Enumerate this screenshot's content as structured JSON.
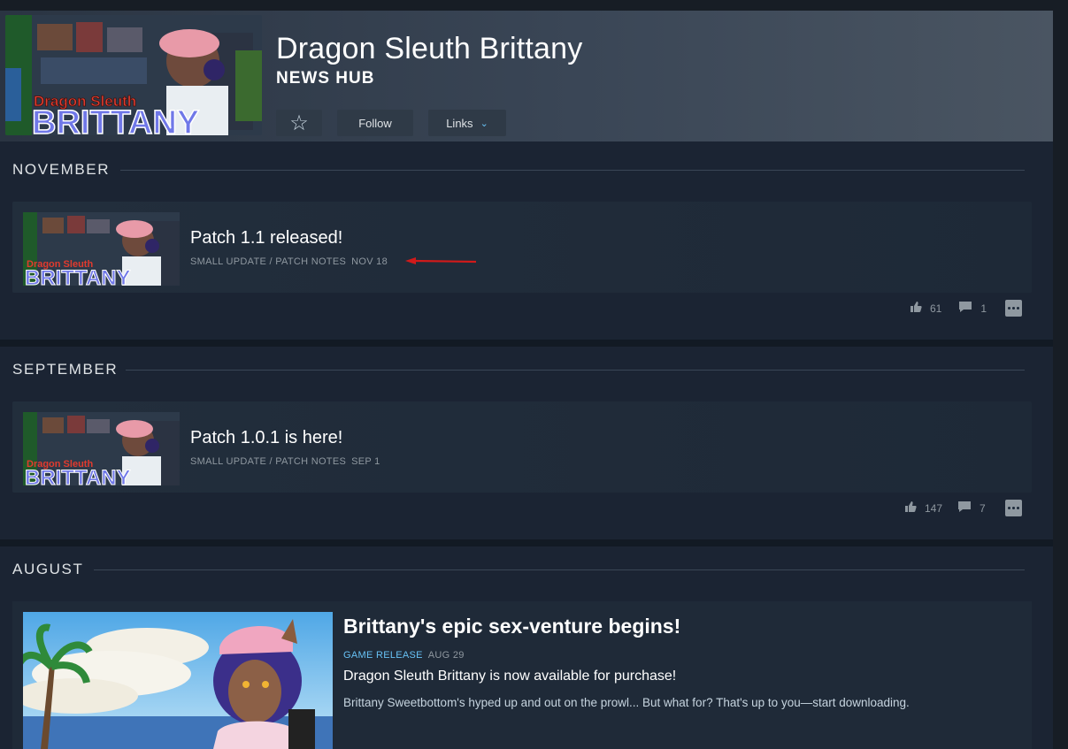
{
  "header": {
    "app_title": "Dragon Sleuth Brittany",
    "subtitle": "NEWS HUB",
    "art_text_top": "Dragon Sleuth",
    "art_text_bottom": "BRITTANY",
    "buttons": {
      "star_icon": "star-outline-icon",
      "follow_label": "Follow",
      "links_label": "Links"
    }
  },
  "sections": [
    {
      "month": "NOVEMBER",
      "posts": [
        {
          "title": "Patch 1.1 released!",
          "category": "SMALL UPDATE / PATCH NOTES",
          "date": "NOV 18",
          "likes": "61",
          "comments": "1"
        }
      ]
    },
    {
      "month": "SEPTEMBER",
      "posts": [
        {
          "title": "Patch 1.0.1 is here!",
          "category": "SMALL UPDATE / PATCH NOTES",
          "date": "SEP 1",
          "likes": "147",
          "comments": "7"
        }
      ]
    },
    {
      "month": "AUGUST",
      "posts": [
        {
          "title": "Brittany's epic sex-venture begins!",
          "category": "GAME RELEASE",
          "date": "AUG 29",
          "subtitle": "Dragon Sleuth Brittany is now available for purchase!",
          "body": "Brittany Sweetbottom's hyped up and out on the prowl... But what for? That's up to you—start downloading."
        }
      ]
    }
  ],
  "colors": {
    "accent_blue": "#67c1f5",
    "annotation_arrow": "#d11a1a",
    "page_bg": "#1b2838"
  }
}
